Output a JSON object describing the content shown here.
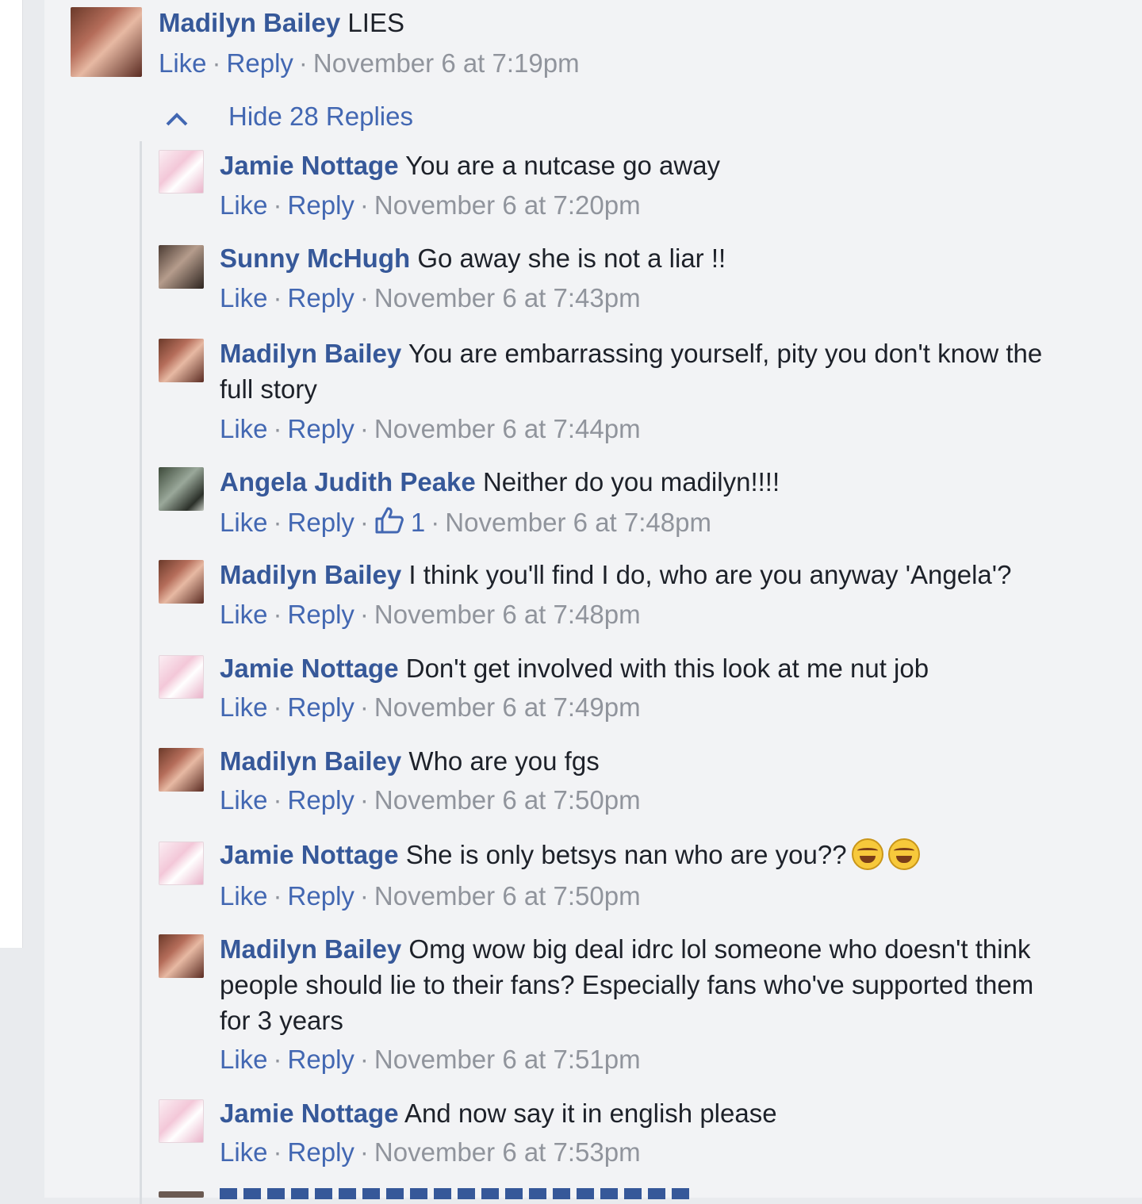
{
  "top_comment": {
    "author": "Madilyn Bailey",
    "text": "LIES",
    "like": "Like",
    "reply": "Reply",
    "timestamp": "November 6 at 7:19pm"
  },
  "hide_replies": "Hide 28 Replies",
  "replies": [
    {
      "author": "Jamie Nottage",
      "text": "You are a nutcase go away",
      "like": "Like",
      "reply": "Reply",
      "timestamp": "November 6 at 7:20pm"
    },
    {
      "author": "Sunny McHugh",
      "text": "Go away she is not a liar !!",
      "like": "Like",
      "reply": "Reply",
      "timestamp": "November 6 at 7:43pm"
    },
    {
      "author": "Madilyn Bailey",
      "text": "You are embarrassing yourself, pity you don't know the full story",
      "like": "Like",
      "reply": "Reply",
      "timestamp": "November 6 at 7:44pm"
    },
    {
      "author": "Angela Judith Peake",
      "text": "Neither do you madilyn!!!!",
      "like": "Like",
      "reply": "Reply",
      "like_count": "1",
      "timestamp": "November 6 at 7:48pm"
    },
    {
      "author": "Madilyn Bailey",
      "text": "I think you'll find I do, who are you anyway 'Angela'?",
      "like": "Like",
      "reply": "Reply",
      "timestamp": "November 6 at 7:48pm"
    },
    {
      "author": "Jamie Nottage",
      "text": "Don't get involved with this look at me nut job",
      "like": "Like",
      "reply": "Reply",
      "timestamp": "November 6 at 7:49pm"
    },
    {
      "author": "Madilyn Bailey",
      "text": "Who are you fgs",
      "like": "Like",
      "reply": "Reply",
      "timestamp": "November 6 at 7:50pm"
    },
    {
      "author": "Jamie Nottage",
      "text": "She is only betsys nan who are you??",
      "like": "Like",
      "reply": "Reply",
      "timestamp": "November 6 at 7:50pm"
    },
    {
      "author": "Madilyn Bailey",
      "text": "Omg wow big deal idrc lol someone who doesn't think people should lie to their fans? Especially fans who've supported them for 3 years",
      "like": "Like",
      "reply": "Reply",
      "timestamp": "November 6 at 7:51pm"
    },
    {
      "author": "Jamie Nottage",
      "text": "And now say it in english please",
      "like": "Like",
      "reply": "Reply",
      "timestamp": "November 6 at 7:53pm"
    }
  ],
  "icons": {
    "collapse": "chevron-up-icon",
    "like_count": "thumbs-up-icon",
    "emoji": "tears-of-joy-emoji-icon"
  },
  "colors": {
    "link": "#4267b2",
    "name": "#365899",
    "meta": "#90949c",
    "background": "#f2f3f5"
  }
}
